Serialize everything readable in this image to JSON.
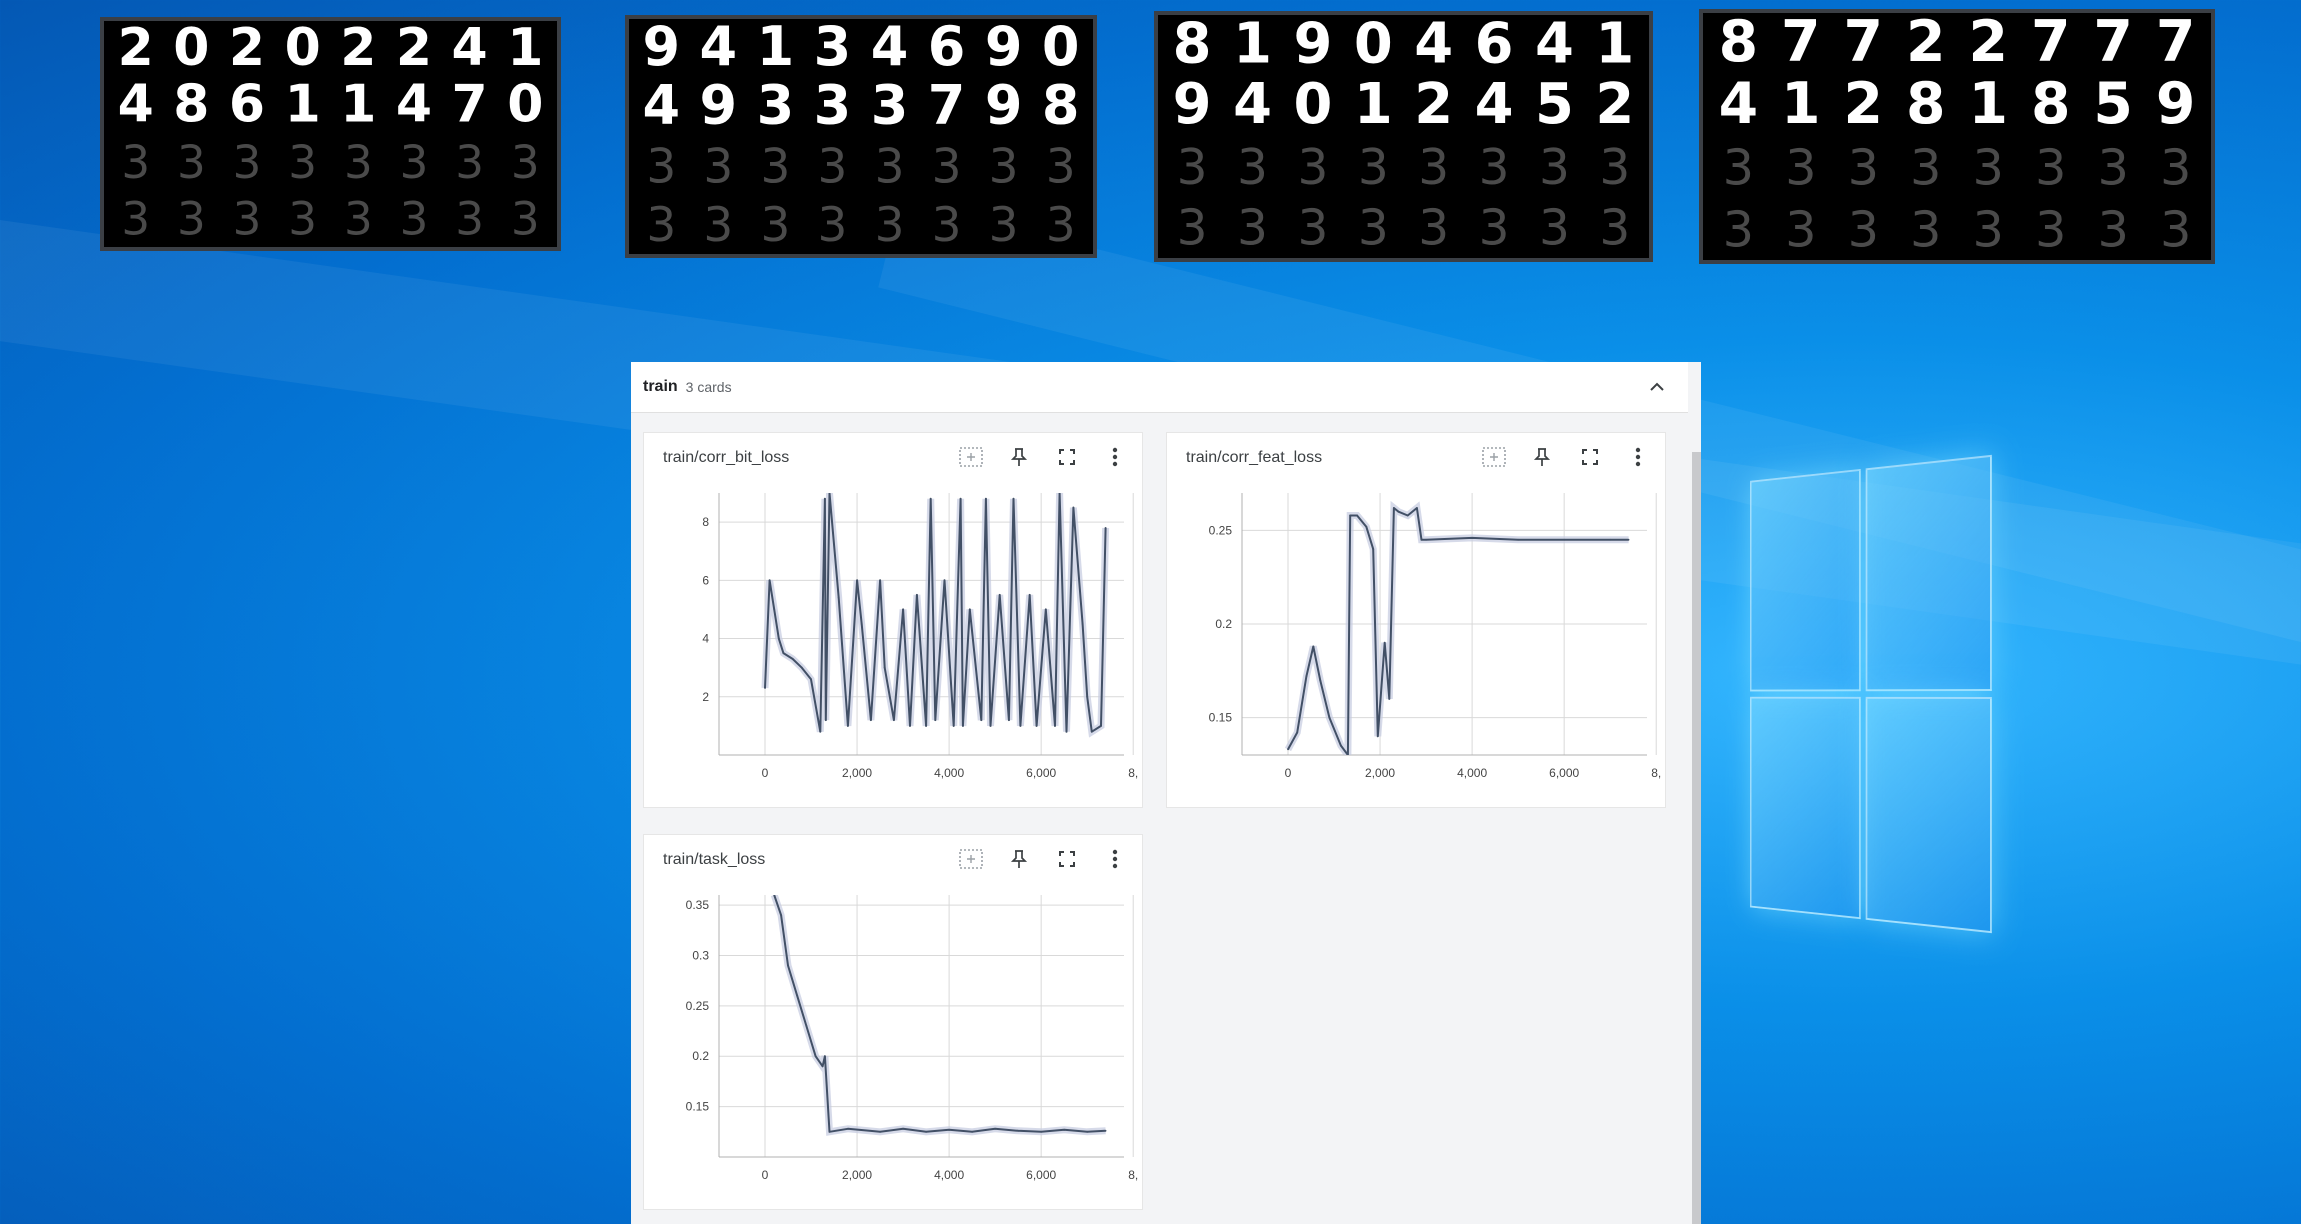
{
  "desktop": {
    "mnist_strips": [
      {
        "row1": [
          "2",
          "0",
          "2",
          "0",
          "2",
          "2",
          "4",
          "1"
        ],
        "row2": [
          "4",
          "8",
          "6",
          "1",
          "1",
          "4",
          "7",
          "0"
        ],
        "ghost": "3"
      },
      {
        "row1": [
          "9",
          "4",
          "1",
          "3",
          "4",
          "6",
          "9",
          "0"
        ],
        "row2": [
          "4",
          "9",
          "3",
          "3",
          "3",
          "7",
          "9",
          "8"
        ],
        "ghost": "3"
      },
      {
        "row1": [
          "8",
          "1",
          "9",
          "0",
          "4",
          "6",
          "4",
          "1"
        ],
        "row2": [
          "9",
          "4",
          "0",
          "1",
          "2",
          "4",
          "5",
          "2"
        ],
        "ghost": "3"
      },
      {
        "row1": [
          "8",
          "7",
          "7",
          "2",
          "2",
          "7",
          "7",
          "7"
        ],
        "row2": [
          "4",
          "1",
          "2",
          "8",
          "1",
          "8",
          "5",
          "9"
        ],
        "ghost": "3"
      }
    ]
  },
  "tensorboard": {
    "group_title": "train",
    "group_count": "3 cards",
    "card_icons": [
      "fit-domain-icon",
      "pin-icon",
      "fullscreen-icon",
      "more-vert-icon"
    ]
  },
  "chart_data": [
    {
      "type": "line",
      "title": "train/corr_bit_loss",
      "x_ticks": [
        "0",
        "2,000",
        "4,000",
        "6,000",
        "8,"
      ],
      "y_ticks": [
        "2",
        "4",
        "6",
        "8"
      ],
      "xlim": [
        -1000,
        7800
      ],
      "ylim": [
        0,
        9
      ],
      "color": "#425066",
      "x": [
        0,
        100,
        200,
        300,
        400,
        600,
        800,
        1000,
        1200,
        1300,
        1320,
        1400,
        1600,
        1800,
        2000,
        2100,
        2300,
        2500,
        2600,
        2800,
        3000,
        3150,
        3300,
        3500,
        3600,
        3700,
        3900,
        4100,
        4250,
        4300,
        4450,
        4700,
        4800,
        4900,
        5100,
        5300,
        5400,
        5550,
        5750,
        5900,
        6100,
        6300,
        6400,
        6550,
        6700,
        6900,
        7000,
        7100,
        7300,
        7400
      ],
      "y": [
        2.3,
        6.0,
        5.0,
        4.0,
        3.5,
        3.3,
        3.0,
        2.6,
        0.8,
        8.8,
        1.2,
        9.0,
        5.4,
        1.0,
        6.0,
        4.5,
        1.2,
        6.0,
        3.0,
        1.2,
        5.0,
        1.0,
        5.5,
        1.0,
        8.8,
        1.2,
        6.0,
        1.0,
        8.8,
        1.0,
        5.0,
        1.2,
        8.8,
        1.0,
        5.5,
        1.2,
        8.8,
        1.0,
        5.5,
        1.0,
        5.0,
        1.0,
        9.0,
        0.8,
        8.5,
        4.5,
        2.0,
        0.8,
        1.0,
        7.8
      ]
    },
    {
      "type": "line",
      "title": "train/corr_feat_loss",
      "x_ticks": [
        "0",
        "2,000",
        "4,000",
        "6,000",
        "8,"
      ],
      "y_ticks": [
        "0.15",
        "0.2",
        "0.25"
      ],
      "xlim": [
        -1000,
        7800
      ],
      "ylim": [
        0.13,
        0.27
      ],
      "color": "#425066",
      "x": [
        0,
        200,
        400,
        550,
        700,
        900,
        1150,
        1300,
        1350,
        1500,
        1700,
        1850,
        1950,
        2100,
        2200,
        2300,
        2400,
        2600,
        2800,
        2900,
        3000,
        4000,
        5000,
        6000,
        7000,
        7400
      ],
      "y": [
        0.133,
        0.142,
        0.172,
        0.188,
        0.17,
        0.15,
        0.135,
        0.13,
        0.258,
        0.258,
        0.252,
        0.24,
        0.14,
        0.19,
        0.16,
        0.262,
        0.26,
        0.258,
        0.262,
        0.245,
        0.245,
        0.246,
        0.245,
        0.245,
        0.245,
        0.245
      ]
    },
    {
      "type": "line",
      "title": "train/task_loss",
      "x_ticks": [
        "0",
        "2,000",
        "4,000",
        "6,000",
        "8,"
      ],
      "y_ticks": [
        "0.15",
        "0.2",
        "0.25",
        "0.3",
        "0.35"
      ],
      "xlim": [
        -1000,
        7800
      ],
      "ylim": [
        0.1,
        0.36
      ],
      "color": "#425066",
      "x": [
        200,
        350,
        500,
        700,
        900,
        1100,
        1250,
        1300,
        1400,
        1800,
        2500,
        3000,
        3500,
        4000,
        4500,
        5000,
        5500,
        6000,
        6500,
        7000,
        7400
      ],
      "y": [
        0.36,
        0.34,
        0.29,
        0.26,
        0.23,
        0.2,
        0.19,
        0.2,
        0.125,
        0.128,
        0.125,
        0.128,
        0.125,
        0.127,
        0.125,
        0.128,
        0.126,
        0.125,
        0.127,
        0.125,
        0.126
      ]
    }
  ]
}
